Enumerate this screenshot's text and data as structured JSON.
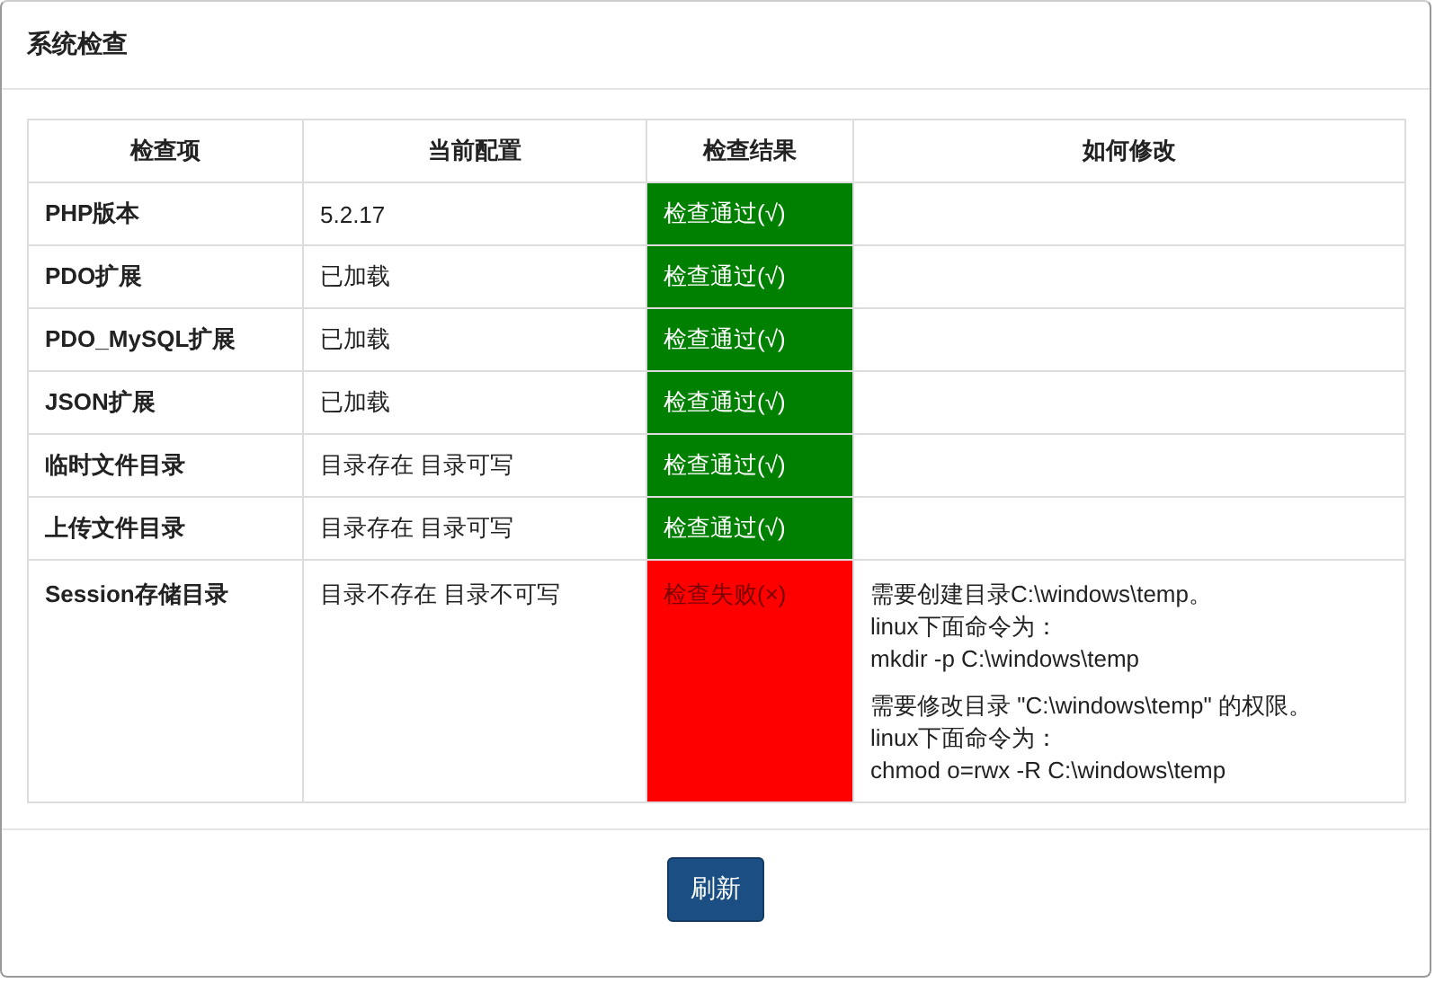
{
  "panel": {
    "title": "系统检查"
  },
  "table": {
    "columns": [
      "检查项",
      "当前配置",
      "检查结果",
      "如何修改"
    ],
    "rows": [
      {
        "item": "PHP版本",
        "config": "5.2.17",
        "result": {
          "passed": true,
          "text": "检查通过(√)"
        },
        "fix": []
      },
      {
        "item": "PDO扩展",
        "config": "已加载",
        "result": {
          "passed": true,
          "text": "检查通过(√)"
        },
        "fix": []
      },
      {
        "item": "PDO_MySQL扩展",
        "config": "已加载",
        "result": {
          "passed": true,
          "text": "检查通过(√)"
        },
        "fix": []
      },
      {
        "item": "JSON扩展",
        "config": "已加载",
        "result": {
          "passed": true,
          "text": "检查通过(√)"
        },
        "fix": []
      },
      {
        "item": "临时文件目录",
        "config": "目录存在 目录可写",
        "result": {
          "passed": true,
          "text": "检查通过(√)"
        },
        "fix": []
      },
      {
        "item": "上传文件目录",
        "config": "目录存在 目录可写",
        "result": {
          "passed": true,
          "text": "检查通过(√)"
        },
        "fix": []
      },
      {
        "item": "Session存储目录",
        "config": "目录不存在 目录不可写",
        "result": {
          "passed": false,
          "text": "检查失败(×)"
        },
        "fix": [
          [
            "需要创建目录C:\\windows\\temp。",
            "linux下面命令为：",
            "mkdir -p C:\\windows\\temp"
          ],
          [
            "需要修改目录 \"C:\\windows\\temp\" 的权限。",
            "linux下面命令为：",
            "chmod o=rwx -R C:\\windows\\temp"
          ]
        ]
      }
    ]
  },
  "button": "刷新"
}
